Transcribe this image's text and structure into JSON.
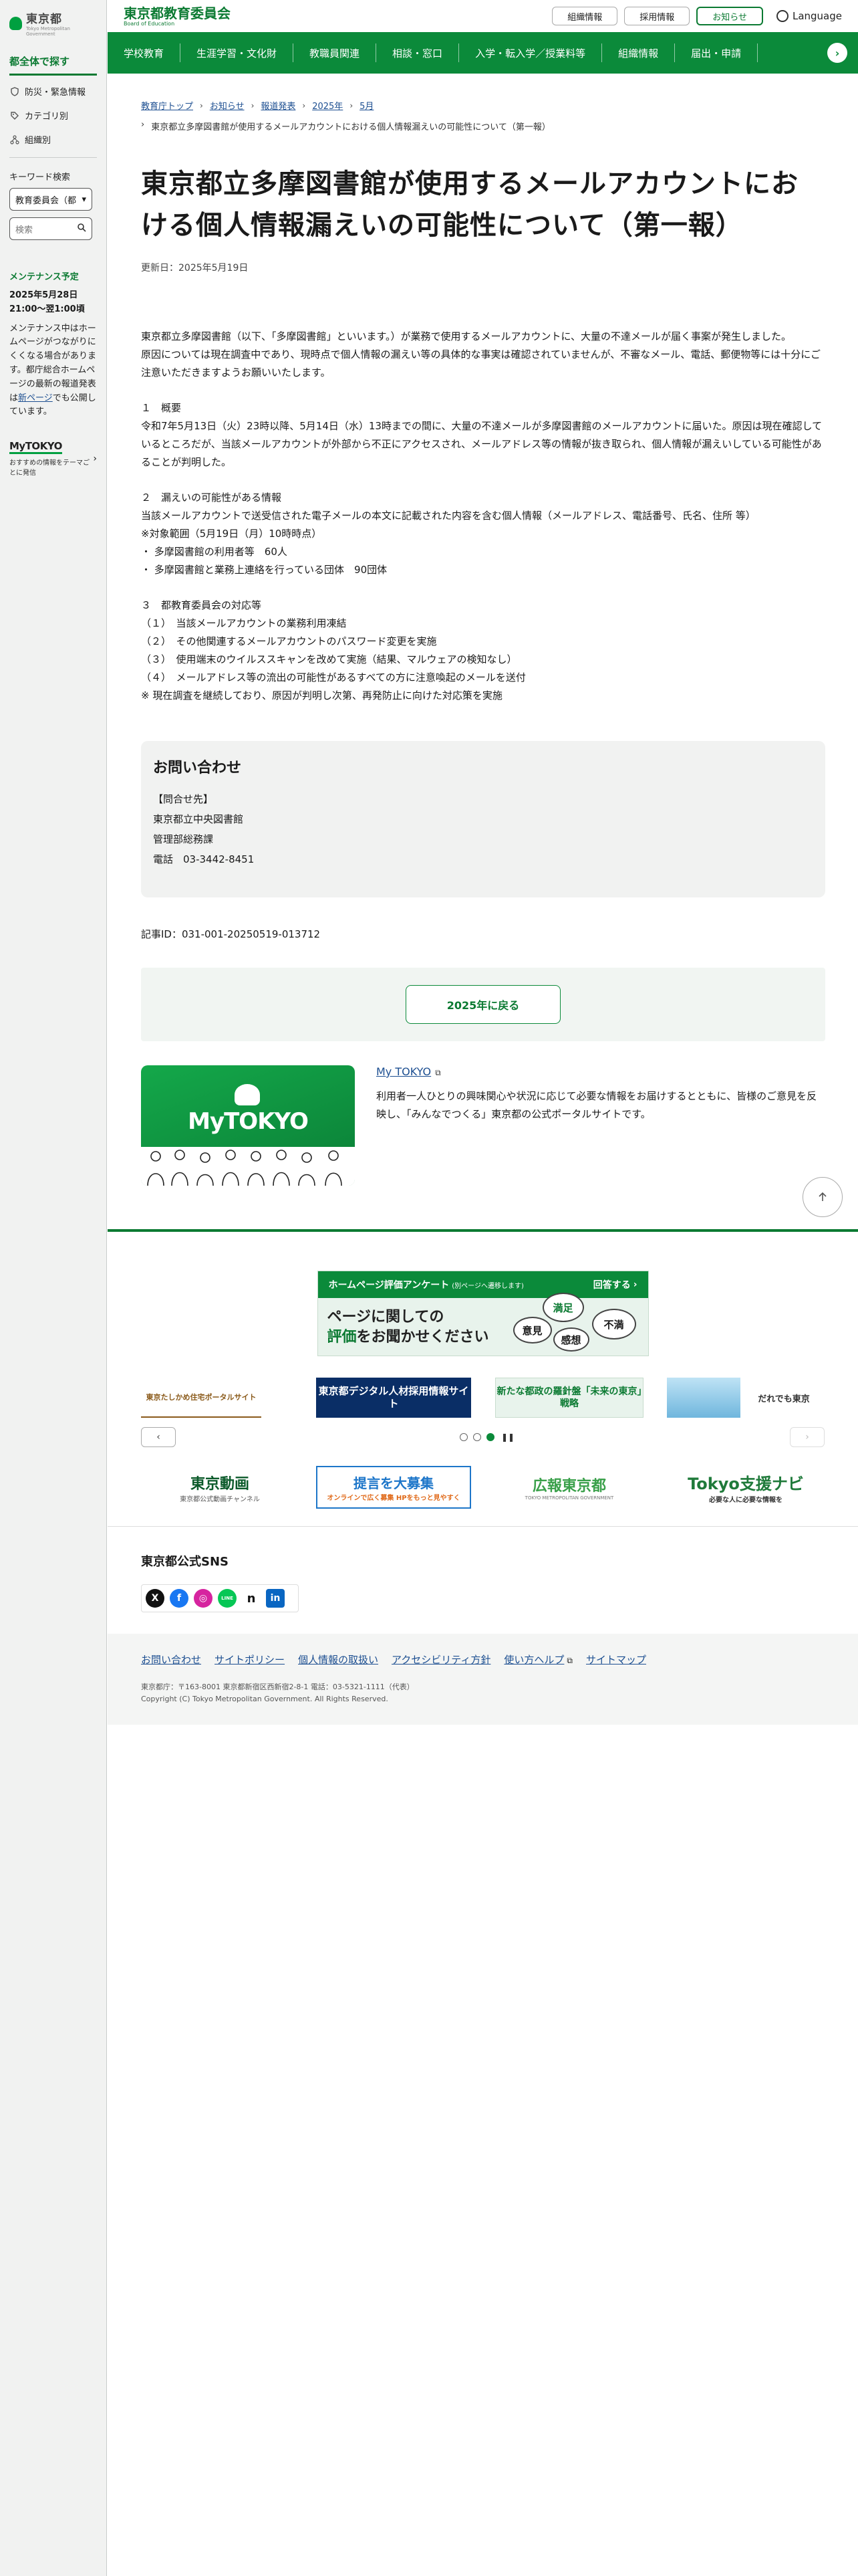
{
  "sidebar": {
    "logo_text": "東京都",
    "logo_sub": "Tokyo Metropolitan Government",
    "heading": "都全体で探す",
    "links": [
      {
        "label": "防災・緊急情報",
        "icon": "shield-icon"
      },
      {
        "label": "カテゴリ別",
        "icon": "category-icon"
      },
      {
        "label": "組織別",
        "icon": "org-icon"
      }
    ],
    "keyword_label": "キーワード検索",
    "select_value": "教育委員会（都",
    "search_placeholder": "検索",
    "maintenance": {
      "title": "メンテナンス予定",
      "date": "2025年5月28日 21:00～翌1:00頃",
      "text_before": "メンテナンス中はホームページがつながりにくくなる場合があります。都庁総合ホームページの最新の報道発表は",
      "link": "新ページ",
      "text_after": "でも公開しています。"
    },
    "mytokyo": {
      "logo": "MyTOKYO",
      "desc": "おすすめの情報をテーマごとに発信"
    }
  },
  "header": {
    "title": "東京都教育委員会",
    "subtitle": "Board of Education",
    "buttons": [
      "組織情報",
      "採用情報",
      "お知らせ"
    ],
    "language": "Language"
  },
  "gnav": [
    "学校教育",
    "生涯学習・文化財",
    "教職員関連",
    "相談・窓口",
    "入学・転入学／授業料等",
    "組織情報",
    "届出・申請"
  ],
  "breadcrumb": [
    "教育庁トップ",
    "お知らせ",
    "報道発表",
    "2025年",
    "5月"
  ],
  "breadcrumb_current": "東京都立多摩図書館が使用するメールアカウントにおける個人情報漏えいの可能性について（第一報）",
  "article": {
    "title": "東京都立多摩図書館が使用するメールアカウントにおける個人情報漏えいの可能性について（第一報）",
    "updated": "更新日：2025年5月19日",
    "intro": [
      "東京都立多摩図書館（以下、「多摩図書館」といいます。）が業務で使用するメールアカウントに、大量の不達メールが届く事案が発生しました。",
      "原因については現在調査中であり、現時点で個人情報の漏えい等の具体的な事実は確認されていませんが、不審なメール、電話、郵便物等には十分にご注意いただきますようお願いいたします。"
    ],
    "s1": [
      "１　概要",
      "令和7年5月13日（火）23時以降、5月14日（水）13時までの間に、大量の不達メールが多摩図書館のメールアカウントに届いた。原因は現在確認しているところだが、当該メールアカウントが外部から不正にアクセスされ、メールアドレス等の情報が抜き取られ、個人情報が漏えいしている可能性があることが判明した。"
    ],
    "s2": [
      "２　漏えいの可能性がある情報",
      "当該メールアカウントで送受信された電子メールの本文に記載された内容を含む個人情報（メールアドレス、電話番号、氏名、住所 等）",
      "※対象範囲（5月19日（月）10時時点）",
      "・ 多摩図書館の利用者等　60人",
      "・ 多摩図書館と業務上連絡を行っている団体　90団体"
    ],
    "s3": [
      "３　都教育委員会の対応等",
      "（１）　当該メールアカウントの業務利用凍結",
      "（２）　その他関連するメールアカウントのパスワード変更を実施",
      "（３）　使用端末のウイルススキャンを改めて実施（結果、マルウェアの検知なし）",
      "（４）　メールアドレス等の流出の可能性があるすべての方に注意喚起のメールを送付",
      "※ 現在調査を継続しており、原因が判明し次第、再発防止に向けた対応策を実施"
    ]
  },
  "inquiry": {
    "title": "お問い合わせ",
    "lines": [
      "【問合せ先】",
      "東京都立中央図書館",
      "管理部総務課",
      "電話　03-3442-8451"
    ]
  },
  "article_id": "記事ID：031-001-20250519-013712",
  "back_button": "2025年に戻る",
  "mytokyo_promo": {
    "banner_title": "MyTOKYO",
    "link": "My TOKYO",
    "description": "利用者一人ひとりの興味関心や状況に応じて必要な情報をお届けするとともに、皆様のご意見を反映し、「みんなでつくる」東京都の公式ポータルサイトです。"
  },
  "footer": {
    "survey": {
      "top": "ホームページ評価アンケート",
      "top_small": "(別ページへ遷移します)",
      "answer": "回答する",
      "line1": "ページに関しての",
      "line2_em": "評価",
      "line2_rest": "をお聞かせください",
      "bubbles": [
        "満足",
        "意見",
        "不満",
        "感想"
      ]
    },
    "banners": [
      "東京たしかめ住宅ポータルサイト",
      "東京都デジタル人材採用情報サイト",
      "新たな都政の羅針盤「未来の東京」戦略",
      "",
      "だれでも東京"
    ],
    "banner_tag": "新たな都政の羅針盤",
    "banners2": [
      "東京都公式動画チャンネル",
      "提言を大募集",
      "広報東京都",
      "Tokyo支援ナビ"
    ],
    "banners2_sub": [
      "東京都公式動画チャンネル",
      "オンラインで広く募集 HPをもっと見やすく",
      "TOKYO METROPOLITAN GOVERNMENT",
      "必要な人に必要な情報を"
    ],
    "sns_title": "東京都公式SNS",
    "sns": [
      "X",
      "f",
      "◎",
      "LINE",
      "n",
      "in"
    ],
    "links": [
      "お問い合わせ",
      "サイトポリシー",
      "個人情報の取扱い",
      "アクセシビリティ方針",
      "使い方ヘルプ",
      "サイトマップ"
    ],
    "address": "東京都庁：〒163-8001 東京都新宿区西新宿2-8-1 電話：03-5321-1111（代表）",
    "copyright": "Copyright (C) Tokyo Metropolitan Government. All Rights Reserved."
  },
  "colors": {
    "primary_green": "#0b8a3a",
    "dark_green": "#0b7a32",
    "link": "#1d4f91"
  }
}
